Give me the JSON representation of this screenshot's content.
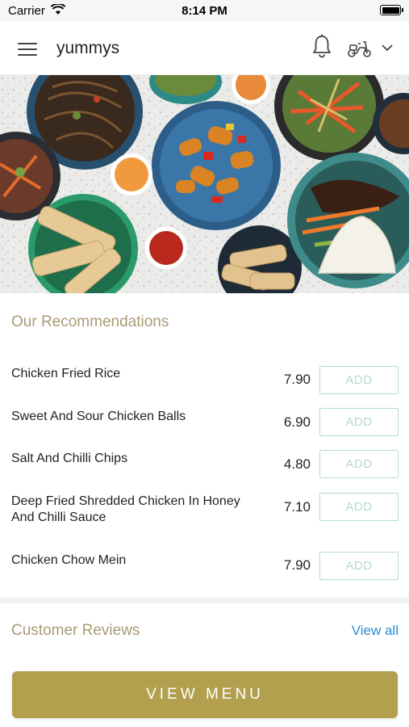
{
  "status_bar": {
    "carrier": "Carrier",
    "time": "8:14 PM"
  },
  "header": {
    "title": "yummys",
    "icons": [
      "menu-icon",
      "bell-icon",
      "scooter-icon",
      "chevron-down-icon"
    ]
  },
  "recommendations": {
    "title": "Our Recommendations",
    "items": [
      {
        "name": "Chicken Fried Rice",
        "price": "7.90",
        "button": "ADD"
      },
      {
        "name": "Sweet And Sour Chicken Balls",
        "price": "6.90",
        "button": "ADD"
      },
      {
        "name": "Salt And Chilli Chips",
        "price": "4.80",
        "button": "ADD"
      },
      {
        "name": "Deep Fried Shredded Chicken In Honey And Chilli Sauce",
        "price": "7.10",
        "button": "ADD"
      },
      {
        "name": "Chicken Chow Mein",
        "price": "7.90",
        "button": "ADD"
      }
    ]
  },
  "reviews": {
    "title": "Customer Reviews",
    "view_all": "View all"
  },
  "footer": {
    "menu_button": "VIEW MENU"
  },
  "colors": {
    "accent_gold": "#b3a04e",
    "section_title": "#a99b74",
    "add_border": "#b7dccd",
    "link_blue": "#2d8ccf"
  }
}
